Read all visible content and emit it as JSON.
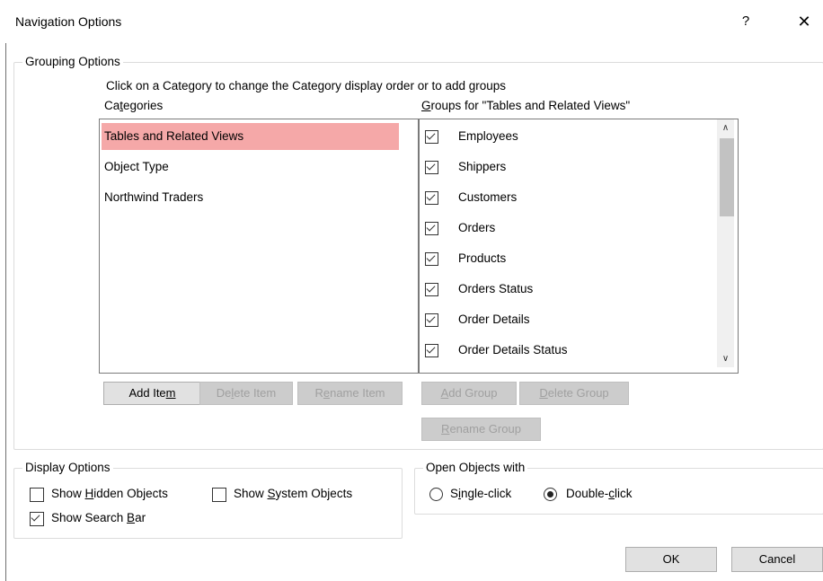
{
  "window": {
    "title": "Navigation Options",
    "help": "?",
    "close": "✕"
  },
  "grouping": {
    "legend": "Grouping Options",
    "instruction": "Click on a Category to change the Category display order or to add groups",
    "categories_label": {
      "pre": "Ca",
      "u": "t",
      "post": "egories"
    },
    "groups_label": {
      "pre": "",
      "u": "G",
      "post": "roups for \"Tables and Related Views\""
    },
    "categories": [
      {
        "label": "Tables and Related Views",
        "selected": true
      },
      {
        "label": "Object Type",
        "selected": false
      },
      {
        "label": "Northwind Traders",
        "selected": false
      }
    ],
    "groups": [
      {
        "label": "Employees",
        "checked": true
      },
      {
        "label": "Shippers",
        "checked": true
      },
      {
        "label": "Customers",
        "checked": true
      },
      {
        "label": "Orders",
        "checked": true
      },
      {
        "label": "Products",
        "checked": true
      },
      {
        "label": "Orders Status",
        "checked": true
      },
      {
        "label": "Order Details",
        "checked": true
      },
      {
        "label": "Order Details Status",
        "checked": true
      }
    ],
    "buttons": {
      "add_item": {
        "pre": "Add Ite",
        "u": "m",
        "post": ""
      },
      "delete_item": {
        "pre": "De",
        "u": "l",
        "post": "ete Item"
      },
      "rename_item": {
        "pre": "R",
        "u": "e",
        "post": "name Item"
      },
      "add_group": {
        "pre": "",
        "u": "A",
        "post": "dd Group"
      },
      "delete_group": {
        "pre": "",
        "u": "D",
        "post": "elete Group"
      },
      "rename_group": {
        "pre": "",
        "u": "R",
        "post": "ename Group"
      }
    }
  },
  "display": {
    "legend": "Display Options",
    "show_hidden": {
      "pre": "Show ",
      "u": "H",
      "post": "idden Objects",
      "checked": false
    },
    "show_system": {
      "pre": "Show ",
      "u": "S",
      "post": "ystem Objects",
      "checked": false
    },
    "show_search": {
      "pre": "Show Search ",
      "u": "B",
      "post": "ar",
      "checked": true
    }
  },
  "open": {
    "legend": "Open Objects with",
    "single": {
      "pre": "S",
      "u": "i",
      "post": "ngle-click",
      "selected": false
    },
    "double": {
      "pre": "Double-",
      "u": "c",
      "post": "lick",
      "selected": true
    }
  },
  "footer": {
    "ok": "OK",
    "cancel": "Cancel"
  }
}
